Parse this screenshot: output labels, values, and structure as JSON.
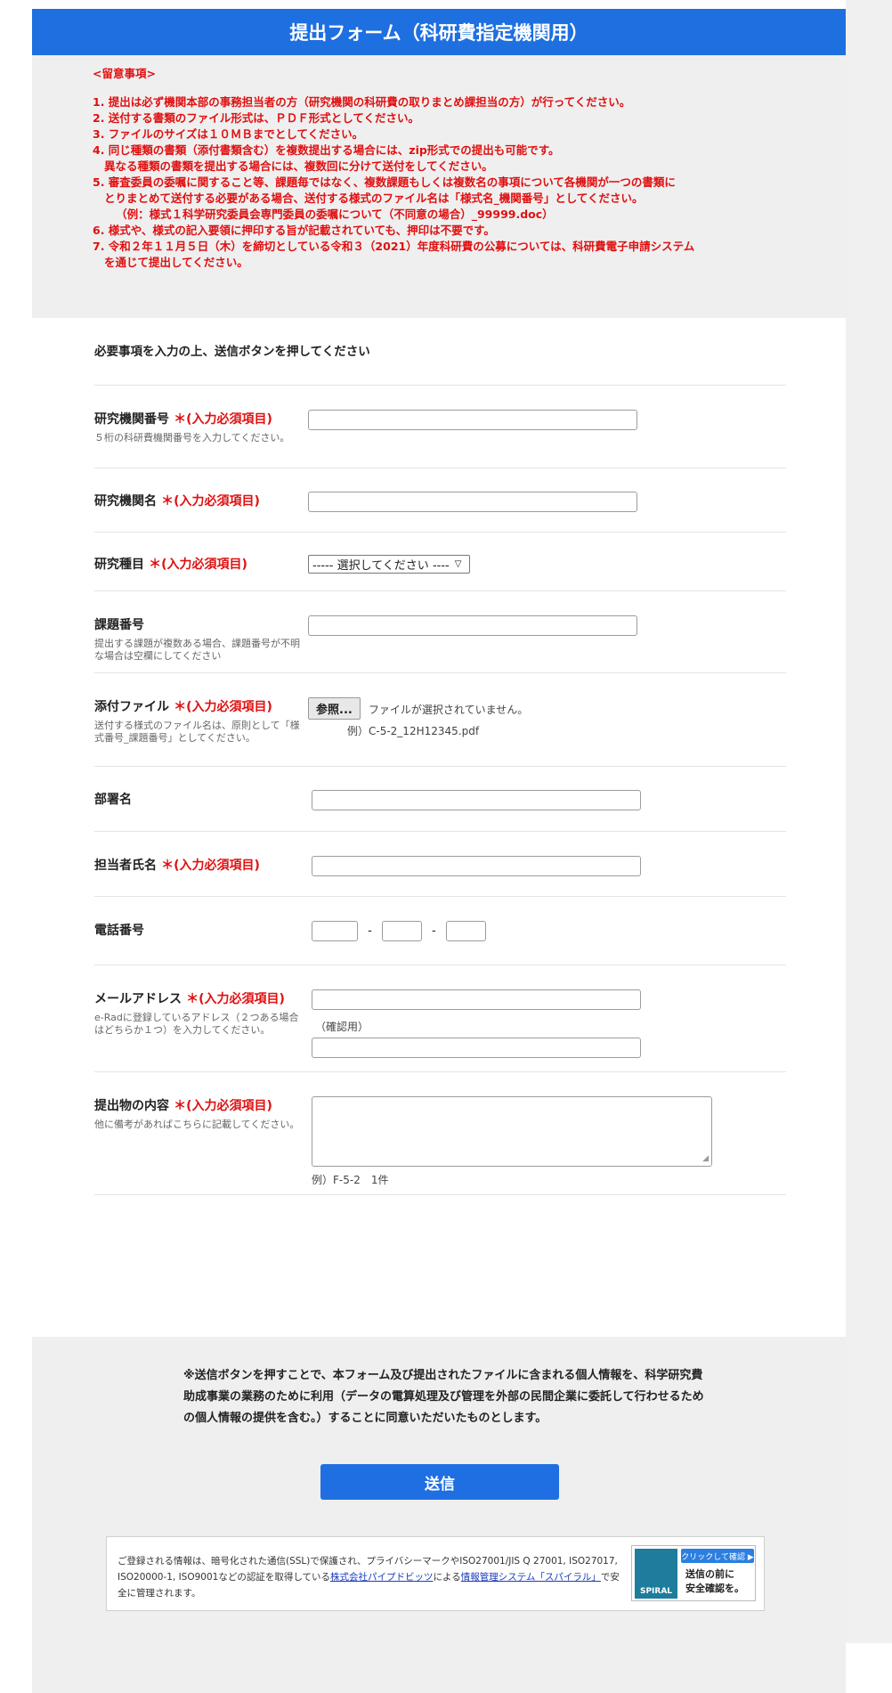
{
  "header": {
    "title": "提出フォーム（科研費指定機関用）"
  },
  "notice": {
    "heading": "<留意事項>",
    "lines": [
      "1. 提出は必ず機関本部の事務担当者の方（研究機関の科研費の取りまとめ課担当の方）が行ってください。",
      "2. 送付する書類のファイル形式は、ＰＤＦ形式としてください。",
      "3. ファイルのサイズは１０ＭＢまでとしてください。",
      "4. 同じ種類の書類（添付書類含む）を複数提出する場合には、zip形式での提出も可能です。",
      "   異なる種類の書類を提出する場合には、複数回に分けて送付をしてください。",
      "5. 審査委員の委嘱に関すること等、課題毎ではなく、複数課題もしくは複数名の事項について各機関が一つの書類に",
      "   とりまとめて送付する必要がある場合、送付する様式のファイル名は「様式名_機関番号」としてください。",
      "      （例：様式１科学研究委員会専門委員の委嘱について（不同意の場合）_99999.doc）",
      "6. 様式や、様式の記入要領に押印する旨が記載されていても、押印は不要です。",
      "7. 令和２年１１月５日（木）を締切としている令和３（2021）年度科研費の公募については、科研費電子申請システム",
      "   を通じて提出してください。"
    ]
  },
  "form": {
    "intro": "必要事項を入力の上、送信ボタンを押してください",
    "required_mark": "＊(入力必須項目)",
    "inst_number": {
      "label": "研究機関番号",
      "help": "５桁の科研費機関番号を入力してください。"
    },
    "inst_name": {
      "label": "研究機関名"
    },
    "category": {
      "label": "研究種目",
      "selected": "----- 選択してください ----"
    },
    "project_number": {
      "label": "課題番号",
      "help": "提出する課題が複数ある場合、課題番号が不明な場合は空欄にしてください"
    },
    "attachment": {
      "label": "添付ファイル",
      "help": "送付する様式のファイル名は、原則として「様式番号_課題番号」としてください。",
      "browse": "参照...",
      "status": "ファイルが選択されていません。",
      "example": "例）C-5-2_12H12345.pdf"
    },
    "department": {
      "label": "部署名"
    },
    "contact_name": {
      "label": "担当者氏名"
    },
    "phone": {
      "label": "電話番号",
      "sep": "-"
    },
    "email": {
      "label": "メールアドレス",
      "help": "e-Radに登録しているアドレス（２つある場合はどちらか１つ）を入力してください。",
      "confirm_label": "（確認用）"
    },
    "content": {
      "label": "提出物の内容",
      "help": "他に備考があればこちらに記載してください。",
      "example": "例）F-5-2　1件"
    }
  },
  "footer": {
    "consent": "※送信ボタンを押すことで、本フォーム及び提出されたファイルに含まれる個人情報を、科学研究費助成事業の業務のために利用（データの電算処理及び管理を外部の民間企業に委託して行わせるための個人情報の提供を含む。）することに同意いただいたものとします。",
    "submit": "送信",
    "ssl": {
      "text_a": "ご登録される情報は、暗号化された通信(SSL)で保護され、プライバシーマークやISO27001/JIS Q 27001, ISO27017, ISO20000-1, ISO9001などの認証を取得している",
      "link1": "株式会社パイプドビッツ",
      "text_b": "による",
      "link2": "情報管理システム「スパイラル」",
      "text_c": "で安全に管理されます。"
    },
    "badge": {
      "logo": "SPIRAL",
      "check": "クリックして確認 ▶",
      "line1": "送信の前に",
      "line2": "安全確認を。"
    }
  },
  "colors": {
    "accent": "#1e6fe0",
    "required": "#e01010"
  }
}
